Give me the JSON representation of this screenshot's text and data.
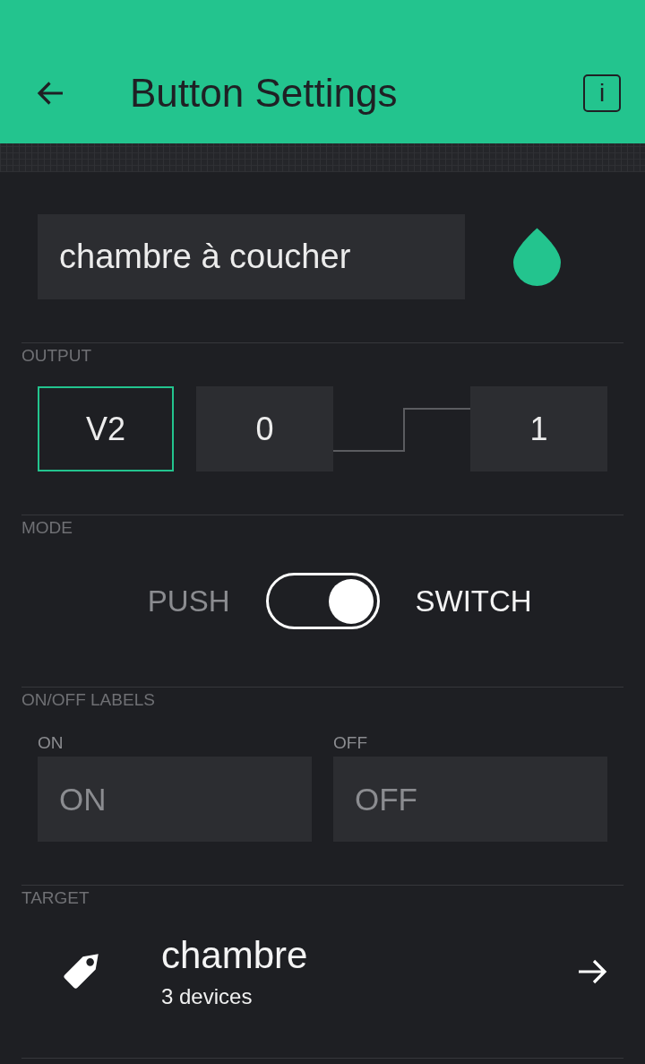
{
  "header": {
    "title": "Button Settings",
    "info_label": "i"
  },
  "name_field": {
    "value": "chambre à coucher"
  },
  "color_picker": {
    "color": "#23c48e"
  },
  "output": {
    "label": "OUTPUT",
    "pin": "V2",
    "min": "0",
    "max": "1"
  },
  "mode": {
    "label": "MODE",
    "left_label": "PUSH",
    "right_label": "SWITCH",
    "on": true
  },
  "labels": {
    "label": "ON/OFF LABELS",
    "fields": [
      {
        "caption": "ON",
        "placeholder": "ON"
      },
      {
        "caption": "OFF",
        "placeholder": "OFF"
      }
    ]
  },
  "target": {
    "label": "TARGET",
    "name": "chambre",
    "subtitle": "3 devices"
  }
}
